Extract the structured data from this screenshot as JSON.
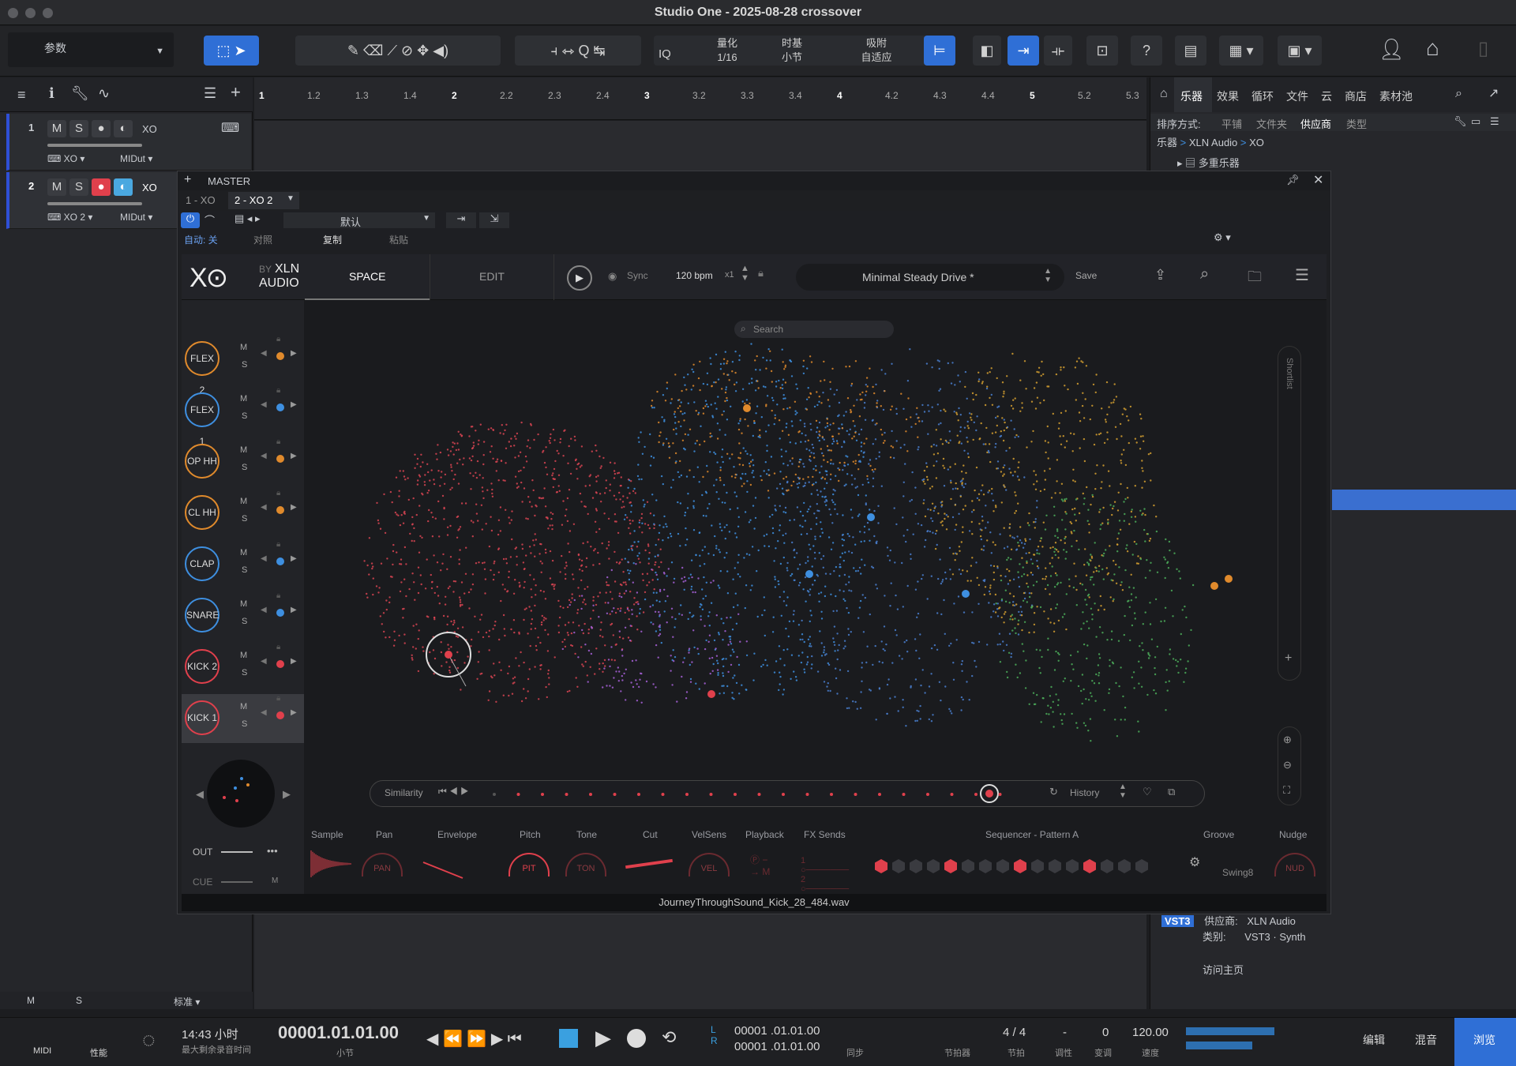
{
  "window": {
    "title": "Studio One - 2025-08-28 crossover"
  },
  "toolbar": {
    "param_label": "参数",
    "iq_label": "IQ",
    "quantize_label": "量化",
    "quantize_value": "1/16",
    "timebase_label": "时基",
    "timebase_value": "小节",
    "snap_label": "吸附",
    "snap_value": "自适应",
    "help_label": "?"
  },
  "tracks": [
    {
      "num": "1",
      "m": "M",
      "s": "S",
      "name": "XO",
      "inst": "XO",
      "out": "MIDut"
    },
    {
      "num": "2",
      "m": "M",
      "s": "S",
      "name": "XO",
      "inst": "XO 2",
      "out": "MIDut"
    }
  ],
  "timeline": {
    "ticks": [
      "1",
      "1.2",
      "1.3",
      "1.4",
      "2",
      "2.2",
      "2.3",
      "2.4",
      "3",
      "3.2",
      "3.3",
      "3.4",
      "4",
      "4.2",
      "4.3",
      "4.4",
      "5",
      "5.2",
      "5.3"
    ]
  },
  "browser": {
    "tabs": [
      "乐器",
      "效果",
      "循环",
      "文件",
      "云",
      "商店",
      "素材池"
    ],
    "sort_label": "排序方式:",
    "sort_options": [
      "平铺",
      "文件夹",
      "供应商",
      "类型"
    ],
    "breadcrumb": [
      "乐器",
      "XLN Audio",
      "XO"
    ],
    "tree_item": "多重乐器",
    "format_badge": "VST3",
    "vendor_label": "供应商:",
    "vendor_value": "XLN Audio",
    "category_label": "类别:",
    "category_value": "VST3 · Synth",
    "home_link": "访问主页"
  },
  "plugin_window": {
    "master_label": "MASTER",
    "tab1": "1 - XO",
    "tab2": "2 - XO 2",
    "preset_default": "默认",
    "auto_label": "自动: 关",
    "compare": "对照",
    "copy": "复制",
    "paste": "粘贴"
  },
  "xo": {
    "logo_by": "BY",
    "logo_xln": "XLN",
    "logo_audio": "AUDIO",
    "tab_space": "SPACE",
    "tab_edit": "EDIT",
    "sync_label": "Sync",
    "bpm": "120 bpm",
    "mult": "x1",
    "preset_name": "Minimal Steady Drive *",
    "save": "Save",
    "search_placeholder": "Search",
    "shortlist": "Shortlist",
    "pads": [
      {
        "label": "FLEX 2",
        "color": "#e08a2c"
      },
      {
        "label": "FLEX 1",
        "color": "#3e8fe0"
      },
      {
        "label": "OP HH",
        "color": "#e08a2c"
      },
      {
        "label": "CL HH",
        "color": "#e08a2c"
      },
      {
        "label": "CLAP",
        "color": "#3e8fe0"
      },
      {
        "label": "SNARE",
        "color": "#3e8fe0"
      },
      {
        "label": "KICK 2",
        "color": "#e0404c"
      },
      {
        "label": "KICK 1",
        "color": "#e0404c"
      }
    ],
    "m_label": "M",
    "s_label": "S",
    "similarity": "Similarity",
    "history": "History",
    "out_label": "OUT",
    "cue_label": "CUE",
    "bottom_labels": [
      "Sample",
      "Pan",
      "Envelope",
      "Pitch",
      "Tone",
      "Cut",
      "VelSens",
      "Playback",
      "FX Sends",
      "Sequencer - Pattern A",
      "Groove",
      "Nudge"
    ],
    "knobs": {
      "pan": "PAN",
      "pit": "PIT",
      "ton": "TON",
      "vel": "VEL",
      "nud": "NUD",
      "m": "M"
    },
    "groove_value": "Swing8",
    "sequencer_steps": [
      1,
      0,
      0,
      0,
      1,
      0,
      0,
      0,
      1,
      0,
      0,
      0,
      1,
      0,
      0,
      0
    ],
    "status_file": "JourneyThroughSound_Kick_28_484.wav"
  },
  "transport": {
    "midi": "MIDI",
    "perf": "性能",
    "time": "14:43 小时",
    "remain": "最大剩余录音时间",
    "position": "00001.01.01.00",
    "pos_unit": "小节",
    "loop_l": "00001 .01.01.00",
    "loop_r": "00001 .01.01.00",
    "sync": "同步",
    "metronome": "节拍器",
    "sig": "4 / 4",
    "sig_label": "节拍",
    "key": "-",
    "key_label": "调性",
    "transpose": "0",
    "transpose_label": "变调",
    "tempo": "120.00",
    "tempo_label": "速度",
    "btn_edit": "编辑",
    "btn_mix": "混音",
    "btn_browse": "浏览"
  },
  "left_footer": {
    "m": "M",
    "s": "S",
    "std": "标准"
  },
  "colors": {
    "accent": "#2f6fd6",
    "red": "#e0404c",
    "orange": "#e08a2c",
    "blue": "#3e8fe0"
  }
}
